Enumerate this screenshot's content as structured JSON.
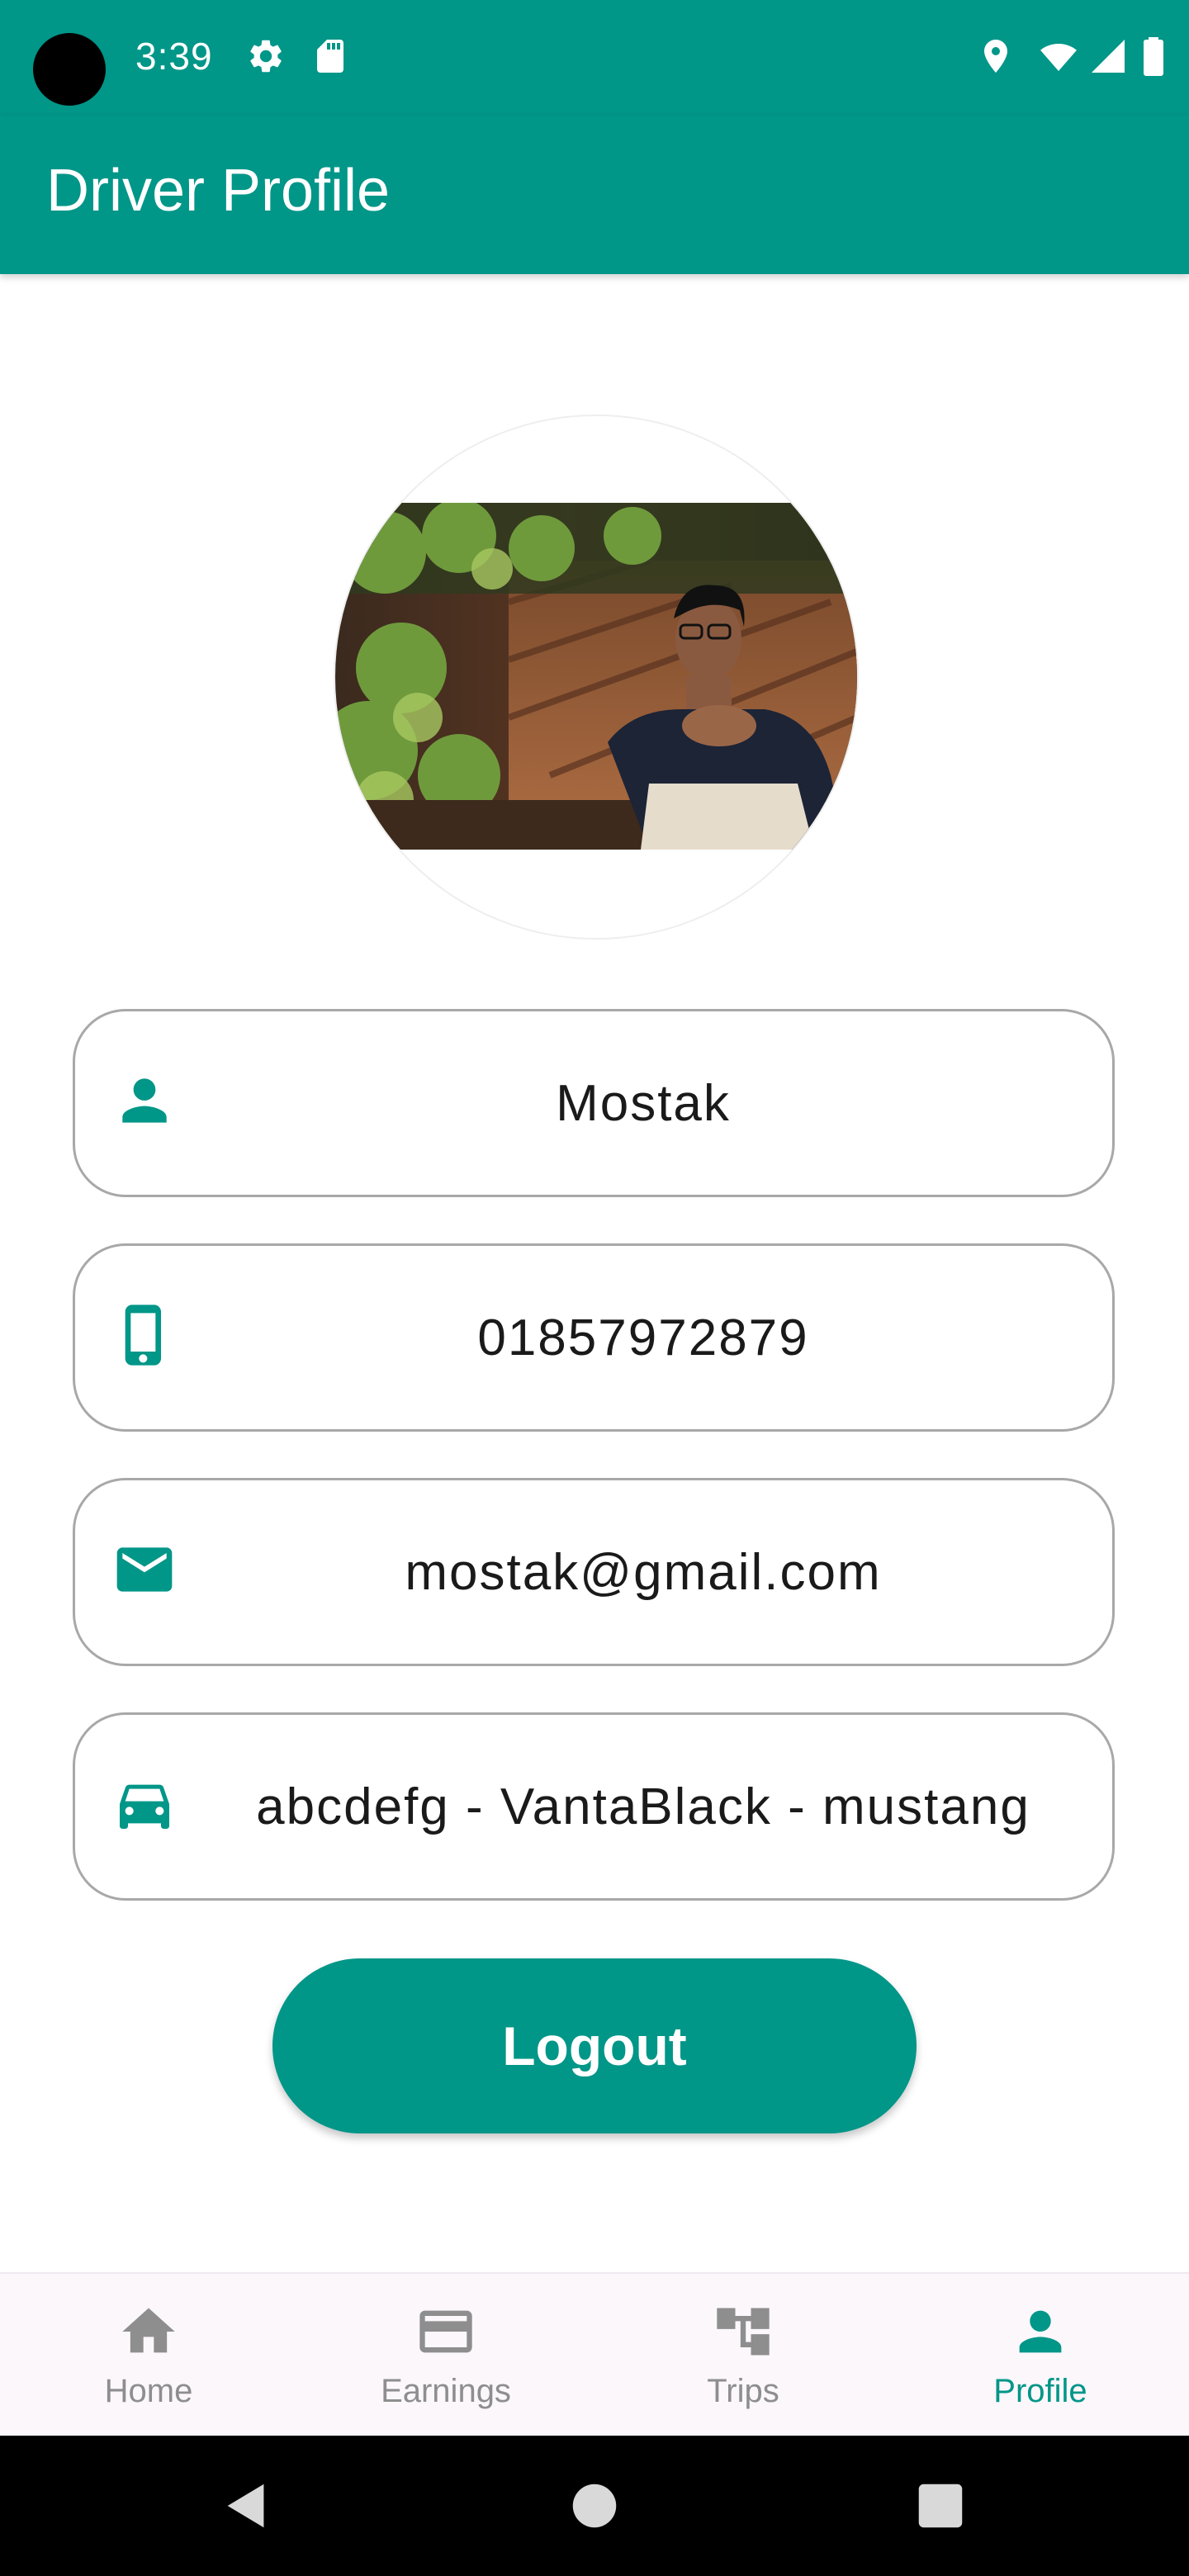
{
  "status_bar": {
    "time": "3:39",
    "left_icons": [
      "gear-icon",
      "sd-card-icon"
    ],
    "right_icons": [
      "location-icon",
      "wifi-icon",
      "signal-icon",
      "battery-icon"
    ]
  },
  "app_bar": {
    "title": "Driver Profile"
  },
  "profile": {
    "photo": "driver-photo",
    "fields": [
      {
        "icon": "person-icon",
        "value": "Mostak"
      },
      {
        "icon": "phone-icon",
        "value": "01857972879"
      },
      {
        "icon": "email-icon",
        "value": "mostak@gmail.com"
      },
      {
        "icon": "car-icon",
        "value": "abcdefg - VantaBlack - mustang"
      }
    ]
  },
  "logout_label": "Logout",
  "bottom_nav": {
    "items": [
      {
        "icon": "home-icon",
        "label": "Home",
        "active": false
      },
      {
        "icon": "earnings-card-icon",
        "label": "Earnings",
        "active": false
      },
      {
        "icon": "trips-tree-icon",
        "label": "Trips",
        "active": false
      },
      {
        "icon": "profile-person-icon",
        "label": "Profile",
        "active": true
      }
    ]
  },
  "system_nav": [
    "back-icon",
    "home-circle-icon",
    "recents-icon"
  ],
  "colors": {
    "primary": "#009688",
    "nav_inactive": "#8e8e8e",
    "field_border": "#a8a8a8"
  }
}
